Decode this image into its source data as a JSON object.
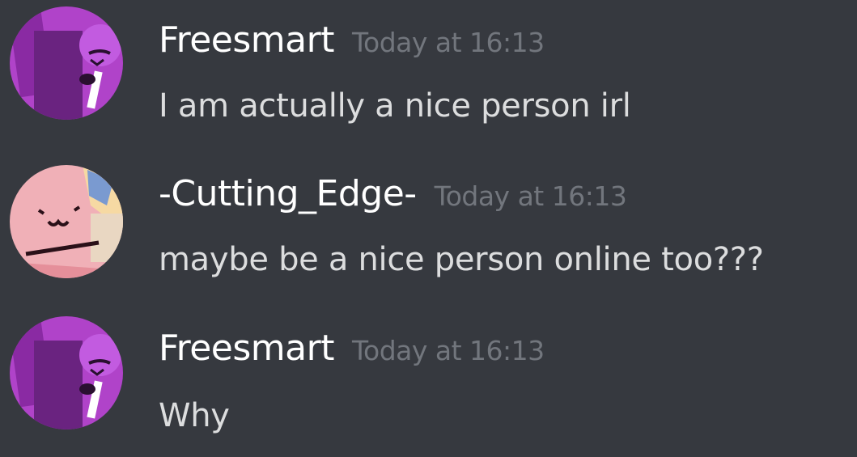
{
  "messages": [
    {
      "username": "Freesmart",
      "timestamp": "Today at 16:13",
      "text": "I am actually a nice person irl",
      "avatar_icon": "purple-character-avatar"
    },
    {
      "username": "-Cutting_Edge-",
      "timestamp": "Today at 16:13",
      "text": "maybe be a nice person online too???",
      "avatar_icon": "pink-character-avatar"
    },
    {
      "username": "Freesmart",
      "timestamp": "Today at 16:13",
      "text": "Why",
      "avatar_icon": "purple-character-avatar"
    }
  ],
  "colors": {
    "background": "#36393f",
    "username": "#ffffff",
    "timestamp": "#72767d",
    "message_text": "#dcddde",
    "purple_avatar": "#a13fc1",
    "pink_avatar": "#f3b3b8"
  }
}
